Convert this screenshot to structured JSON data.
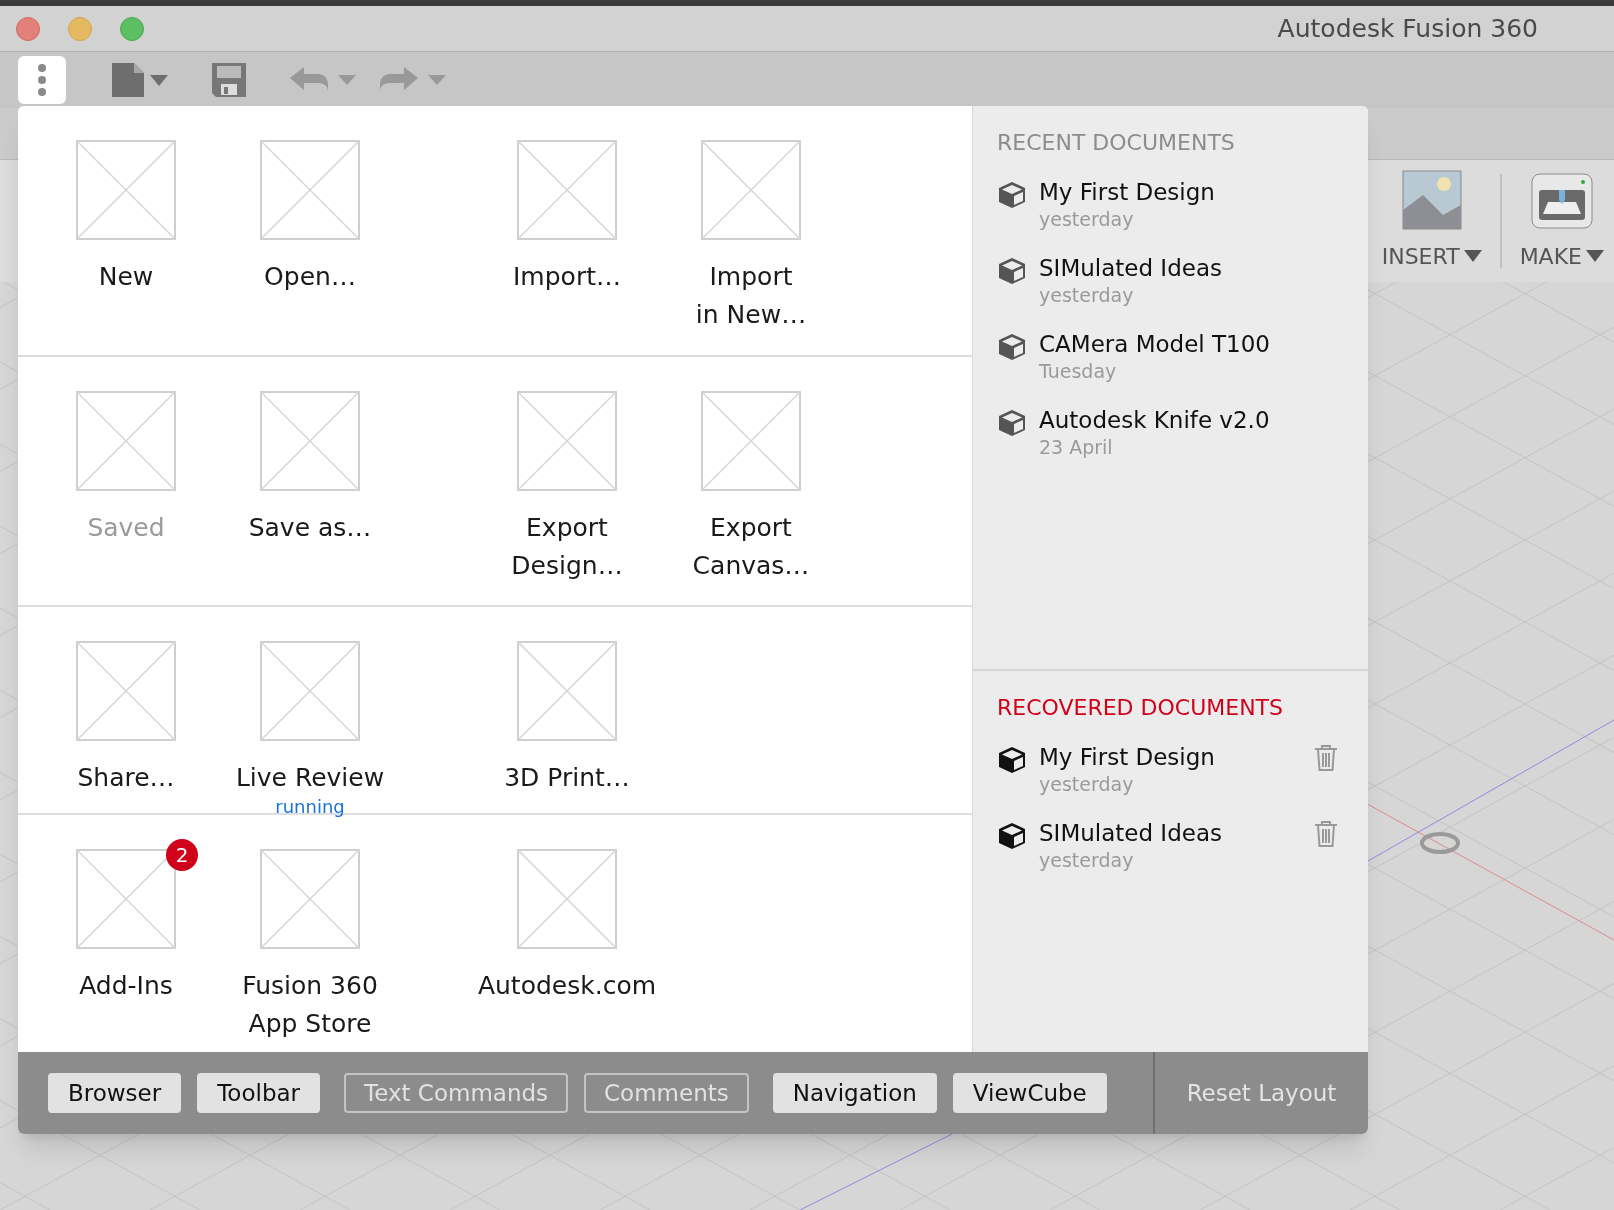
{
  "window": {
    "title": "Autodesk Fusion 360"
  },
  "ribbon": [
    {
      "label": "INSERT",
      "kind": "image"
    },
    {
      "label": "MAKE",
      "kind": "printer"
    }
  ],
  "file_menu": {
    "groups": [
      {
        "items": [
          {
            "label": "New",
            "disabled": false
          },
          {
            "label": "Open…",
            "disabled": false
          },
          {
            "label": "Import…",
            "disabled": false
          },
          {
            "label": "Import\nin New…",
            "disabled": false
          }
        ]
      },
      {
        "items": [
          {
            "label": "Saved",
            "disabled": true
          },
          {
            "label": "Save as…",
            "disabled": false
          },
          {
            "label": "Export\nDesign…",
            "disabled": false
          },
          {
            "label": "Export\nCanvas…",
            "disabled": false
          }
        ]
      },
      {
        "items": [
          {
            "label": "Share…",
            "disabled": false
          },
          {
            "label": "Live Review",
            "status": "running",
            "disabled": false
          },
          {
            "label": "3D Print…",
            "disabled": false
          }
        ]
      },
      {
        "items": [
          {
            "label": "Add-Ins",
            "badge": "2",
            "disabled": false
          },
          {
            "label": "Fusion 360\nApp Store",
            "disabled": false
          },
          {
            "label": "Autodesk.com",
            "disabled": false
          }
        ]
      }
    ]
  },
  "recent_documents": {
    "heading": "RECENT DOCUMENTS",
    "items": [
      {
        "name": "My First Design",
        "date": "yesterday"
      },
      {
        "name": "SIMulated Ideas",
        "date": "yesterday"
      },
      {
        "name": "CAMera Model T100",
        "date": "Tuesday"
      },
      {
        "name": "Autodesk Knife v2.0",
        "date": "23 April"
      }
    ]
  },
  "recovered_documents": {
    "heading": "RECOVERED DOCUMENTS",
    "items": [
      {
        "name": "My First Design",
        "date": "yesterday"
      },
      {
        "name": "SIMulated Ideas",
        "date": "yesterday"
      }
    ]
  },
  "layout_bar": {
    "toggles": [
      {
        "label": "Browser",
        "on": true
      },
      {
        "label": "Toolbar",
        "on": true
      },
      {
        "label": "Text Commands",
        "on": false
      },
      {
        "label": "Comments",
        "on": false
      },
      {
        "label": "Navigation",
        "on": true
      },
      {
        "label": "ViewCube",
        "on": true
      }
    ],
    "reset": "Reset Layout"
  }
}
